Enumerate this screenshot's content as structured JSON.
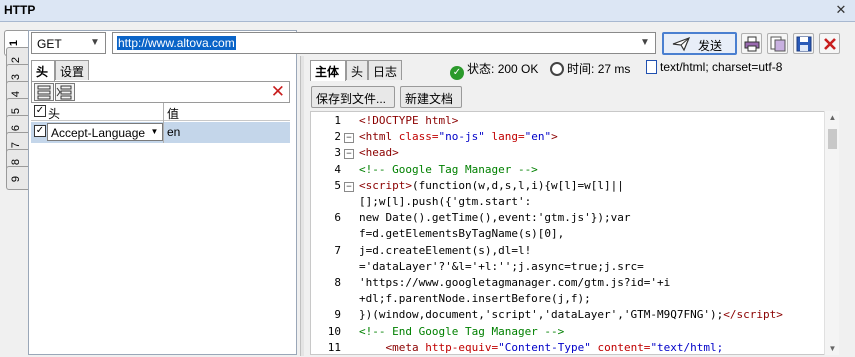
{
  "window": {
    "title": "HTTP",
    "close_glyph": "✕"
  },
  "vertical_tabs": [
    "1",
    "2",
    "3",
    "4",
    "5",
    "6",
    "7",
    "8",
    "9"
  ],
  "request": {
    "method": "GET",
    "url": "http://www.altova.com",
    "send_label": "发送"
  },
  "left_tabs": {
    "headers": "头",
    "settings": "设置"
  },
  "header_grid": {
    "col_name": "头",
    "col_value": "值",
    "rows": [
      {
        "checked": true,
        "name": "Accept-Language",
        "value": "en"
      }
    ]
  },
  "response_tabs": {
    "body": "主体",
    "headers": "头",
    "log": "日志"
  },
  "status": {
    "status_label": "状态:",
    "status_value": "200 OK",
    "time_label": "时间:",
    "time_value": "27 ms",
    "content_type": "text/html; charset=utf-8"
  },
  "actions": {
    "save_to_file": "保存到文件...",
    "new_document": "新建文档"
  },
  "code_lines": [
    {
      "n": "1",
      "fold": "",
      "html": "<span class=\"t-tag\">&lt;!DOCTYPE html&gt;</span>"
    },
    {
      "n": "2",
      "fold": "−",
      "html": "<span class=\"t-tag\">&lt;html</span> <span class=\"t-attr\">class=</span><span class=\"t-val\">\"no-js\"</span> <span class=\"t-attr\">lang=</span><span class=\"t-val\">\"en\"</span><span class=\"t-tag\">&gt;</span>"
    },
    {
      "n": "3",
      "fold": "−",
      "html": "<span class=\"t-tag\">&lt;head&gt;</span>"
    },
    {
      "n": "4",
      "fold": "",
      "html": "<span class=\"t-com\">&lt;!-- Google Tag Manager --&gt;</span>"
    },
    {
      "n": "5",
      "fold": "−",
      "html": "<span class=\"t-tag\">&lt;script&gt;</span>(function(w,d,s,l,i){w[l]=w[l]||"
    },
    {
      "n": "",
      "fold": "",
      "html": "[];w[l].push({'gtm.start':"
    },
    {
      "n": "6",
      "fold": "",
      "html": "new Date().getTime(),event:'gtm.js'});var"
    },
    {
      "n": "",
      "fold": "",
      "html": "f=d.getElementsByTagName(s)[0],"
    },
    {
      "n": "7",
      "fold": "",
      "html": "j=d.createElement(s),dl=l!"
    },
    {
      "n": "",
      "fold": "",
      "html": "='dataLayer'?'&amp;l='+l:'';j.async=true;j.src="
    },
    {
      "n": "8",
      "fold": "",
      "html": "'https://www.googletagmanager.com/gtm.js?id='+i"
    },
    {
      "n": "",
      "fold": "",
      "html": "+dl;f.parentNode.insertBefore(j,f);"
    },
    {
      "n": "9",
      "fold": "",
      "html": "})(window,document,'script','dataLayer','GTM-M9Q7FNG');<span class=\"t-tag\">&lt;/script&gt;</span>"
    },
    {
      "n": "10",
      "fold": "",
      "html": "<span class=\"t-com\">&lt;!-- End Google Tag Manager --&gt;</span>"
    },
    {
      "n": "11",
      "fold": "",
      "html": "    <span class=\"t-tag\">&lt;meta</span> <span class=\"t-attr\">http-equiv=</span><span class=\"t-val\">\"Content-Type\"</span> <span class=\"t-attr\">content=</span><span class=\"t-val\">\"text/html;</span>"
    }
  ],
  "icons": {
    "send": "paper-plane-icon",
    "print": "print-icon",
    "copy": "copy-icon",
    "save": "save-icon",
    "close": "close-icon"
  },
  "colors": {
    "accent": "#0a64c8",
    "selected_row": "#c4d6ea",
    "delete": "#c81e1e"
  }
}
